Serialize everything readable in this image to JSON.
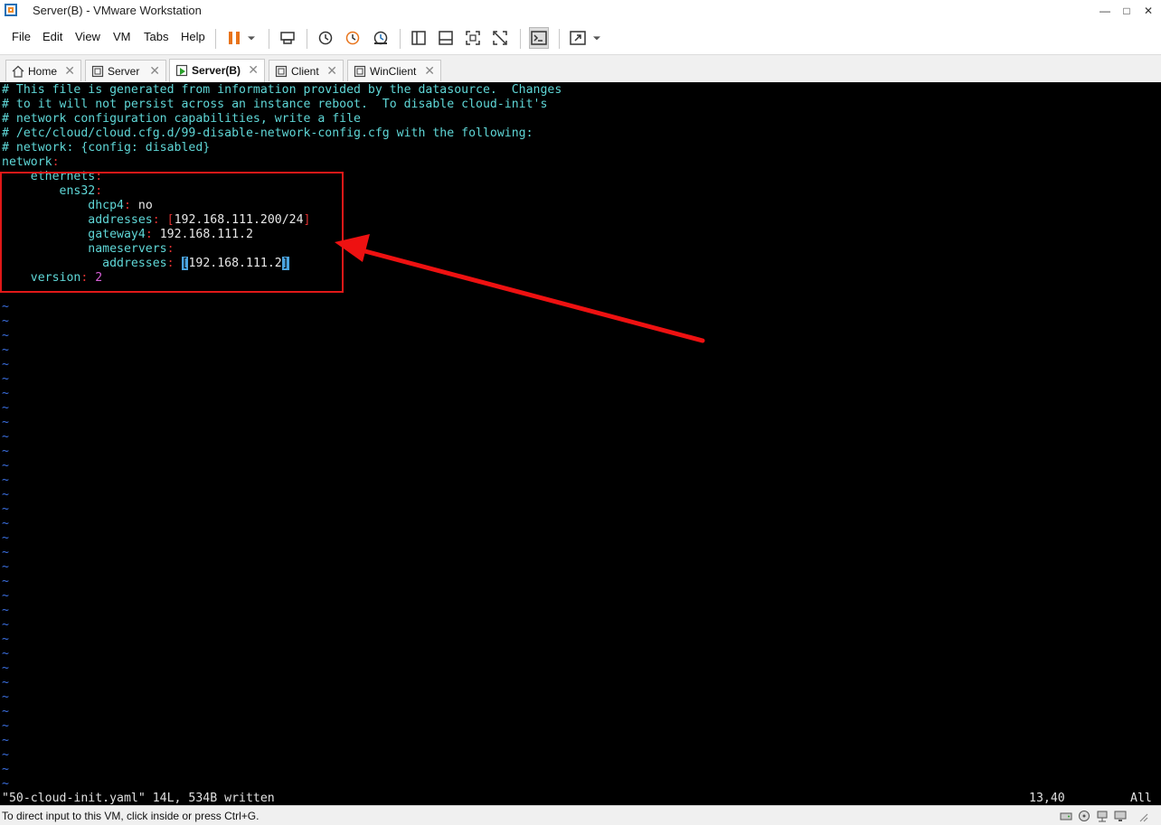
{
  "window": {
    "title": "Server(B) - VMware Workstation"
  },
  "menu": [
    "File",
    "Edit",
    "View",
    "VM",
    "Tabs",
    "Help"
  ],
  "toolbar_icons": [
    "pause-icon",
    "dropdown-icon",
    "send-ctrl-alt-del-icon",
    "snapshot-take-icon",
    "snapshot-revert-icon",
    "snapshot-manager-icon",
    "view-library-icon",
    "view-thumbnail-icon",
    "fullscreen-icon",
    "unity-icon",
    "console-view-icon",
    "stretch-guest-icon"
  ],
  "tabs": [
    {
      "label": "Home",
      "icon": "home-icon",
      "active": false
    },
    {
      "label": "Server",
      "icon": "vm-icon",
      "active": false
    },
    {
      "label": "Server(B)",
      "icon": "vm-running-icon",
      "active": true
    },
    {
      "label": "Client",
      "icon": "vm-icon",
      "active": false
    },
    {
      "label": "WinClient",
      "icon": "vm-icon",
      "active": false
    }
  ],
  "console": {
    "comments": [
      "# This file is generated from information provided by the datasource.  Changes",
      "# to it will not persist across an instance reboot.  To disable cloud-init's",
      "# network configuration capabilities, write a file",
      "# /etc/cloud/cloud.cfg.d/99-disable-network-config.cfg with the following:",
      "# network: {config: disabled}"
    ],
    "network_key": "network",
    "ethernets_key": "ethernets",
    "iface_key": "ens32",
    "dhcp4_key": "dhcp4",
    "dhcp4_val": "no",
    "addresses_key": "addresses",
    "addresses_val": "192.168.111.200/24",
    "gateway4_key": "gateway4",
    "gateway4_val": "192.168.111.2",
    "nameservers_key": "nameservers",
    "ns_addresses_key": "addresses",
    "ns_addresses_val": "192.168.111.2",
    "version_key": "version",
    "version_val": "2",
    "status_message": "\"50-cloud-init.yaml\" 14L, 534B written",
    "cursor_position": "13,40",
    "scroll_position": "All"
  },
  "statusbar": {
    "text": "To direct input to this VM, click inside or press Ctrl+G."
  },
  "colors": {
    "highlight_box": "#e01818",
    "arrow": "#ee1111",
    "yaml_key": "#5fd7d7",
    "vim_tilde": "#3a6fe0"
  }
}
